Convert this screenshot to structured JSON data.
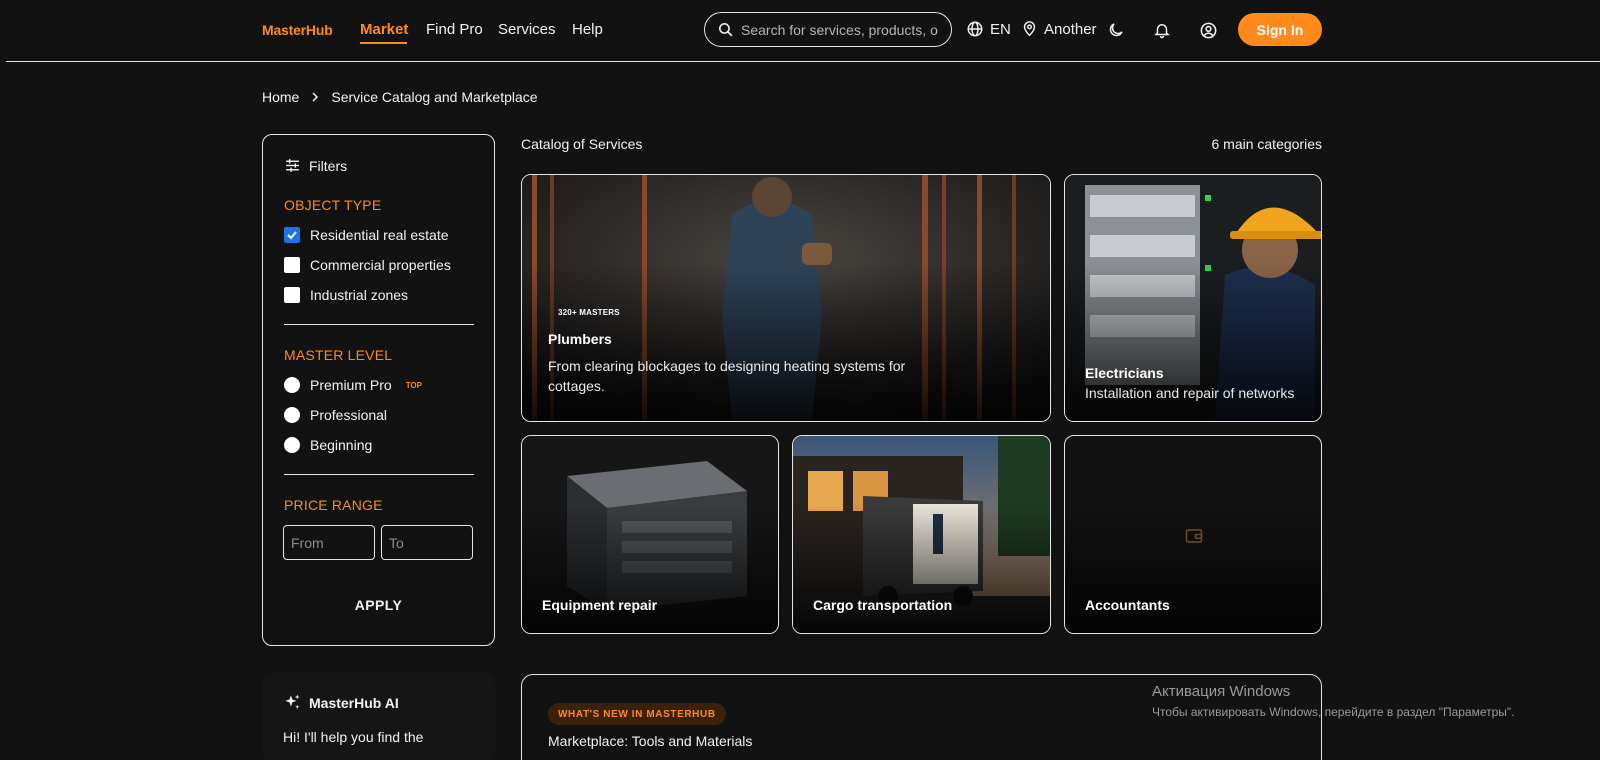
{
  "header": {
    "logo": "MasterHub",
    "nav": [
      "Market",
      "Find Pro",
      "Services",
      "Help"
    ],
    "search_placeholder": "Search for services, products, o",
    "language": "EN",
    "location": "Another",
    "signin_label": "Sign In",
    "accent_color": "#ff8a1c"
  },
  "breadcrumb": {
    "home": "Home",
    "current": "Service Catalog and Marketplace"
  },
  "filters": {
    "title": "Filters",
    "object_type": {
      "title": "OBJECT TYPE",
      "options": [
        {
          "label": "Residential real estate",
          "checked": true
        },
        {
          "label": "Commercial properties",
          "checked": false
        },
        {
          "label": "Industrial zones",
          "checked": false
        }
      ]
    },
    "master_level": {
      "title": "MASTER LEVEL",
      "options": [
        {
          "label": "Premium Pro",
          "badge": "TOP"
        },
        {
          "label": "Professional"
        },
        {
          "label": "Beginning"
        }
      ]
    },
    "price": {
      "title": "PRICE RANGE",
      "from_placeholder": "From",
      "to_placeholder": "To"
    },
    "apply_label": "APPLY"
  },
  "ai": {
    "title": "MasterHub AI",
    "text": "Hi! I'll help you find the"
  },
  "catalog": {
    "title": "Catalog of Services",
    "count": "6 main categories",
    "cards": [
      {
        "title": "Plumbers",
        "masters": "320+ MASTERS",
        "desc": "From clearing blockages to designing heating systems for cottages."
      },
      {
        "title": "Electricians",
        "desc": "Installation and repair of networks"
      },
      {
        "title": "Equipment repair"
      },
      {
        "title": "Cargo transportation"
      },
      {
        "title": "Accountants"
      }
    ]
  },
  "news": {
    "badge": "WHAT'S NEW IN MASTERHUB",
    "title": "Marketplace: Tools and Materials"
  },
  "watermark": {
    "line1": "Активация Windows",
    "line2": "Чтобы активировать Windows, перейдите в раздел \"Параметры\"."
  }
}
